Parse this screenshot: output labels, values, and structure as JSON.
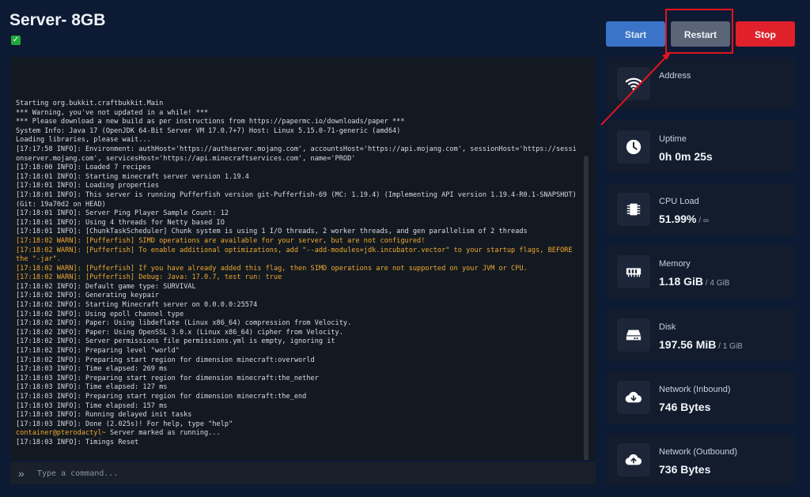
{
  "server": {
    "title": "Server- 8GB",
    "status_icon": "check-icon"
  },
  "controls": {
    "start_label": "Start",
    "restart_label": "Restart",
    "stop_label": "Stop"
  },
  "console": {
    "lines": [
      {
        "text": "Starting org.bukkit.craftbukkit.Main",
        "type": "info"
      },
      {
        "text": "*** Warning, you've not updated in a while! ***",
        "type": "info"
      },
      {
        "text": "*** Please download a new build as per instructions from https://papermc.io/downloads/paper ***",
        "type": "info"
      },
      {
        "text": "System Info: Java 17 (OpenJDK 64-Bit Server VM 17.0.7+7) Host: Linux 5.15.0-71-generic (amd64)",
        "type": "info"
      },
      {
        "text": "Loading libraries, please wait...",
        "type": "info"
      },
      {
        "text": "[17:17:58 INFO]: Environment: authHost='https://authserver.mojang.com', accountsHost='https://api.mojang.com', sessionHost='https://sessionserver.mojang.com', servicesHost='https://api.minecraftservices.com', name='PROD'",
        "type": "info"
      },
      {
        "text": "[17:18:00 INFO]: Loaded 7 recipes",
        "type": "info"
      },
      {
        "text": "[17:18:01 INFO]: Starting minecraft server version 1.19.4",
        "type": "info"
      },
      {
        "text": "[17:18:01 INFO]: Loading properties",
        "type": "info"
      },
      {
        "text": "[17:18:01 INFO]: This server is running Pufferfish version git-Pufferfish-69 (MC: 1.19.4) (Implementing API version 1.19.4-R0.1-SNAPSHOT) (Git: 19a70d2 on HEAD)",
        "type": "info"
      },
      {
        "text": "[17:18:01 INFO]: Server Ping Player Sample Count: 12",
        "type": "info"
      },
      {
        "text": "[17:18:01 INFO]: Using 4 threads for Netty based IO",
        "type": "info"
      },
      {
        "text": "[17:18:01 INFO]: [ChunkTaskScheduler] Chunk system is using 1 I/O threads, 2 worker threads, and gen parallelism of 2 threads",
        "type": "info"
      },
      {
        "text": "[17:18:02 WARN]: [Pufferfish] SIMD operations are available for your server, but are not configured!",
        "type": "warn"
      },
      {
        "text": "[17:18:02 WARN]: [Pufferfish] To enable additional optimizations, add \"--add-modules=jdk.incubator.vector\" to your startup flags, BEFORE the \"-jar\".",
        "type": "warn"
      },
      {
        "text": "[17:18:02 WARN]: [Pufferfish] If you have already added this flag, then SIMD operations are not supported on your JVM or CPU.",
        "type": "warn"
      },
      {
        "text": "[17:18:02 WARN]: [Pufferfish] Debug: Java: 17.0.7, test run: true",
        "type": "warn"
      },
      {
        "text": "[17:18:02 INFO]: Default game type: SURVIVAL",
        "type": "info"
      },
      {
        "text": "[17:18:02 INFO]: Generating keypair",
        "type": "info"
      },
      {
        "text": "[17:18:02 INFO]: Starting Minecraft server on 0.0.0.0:25574",
        "type": "info"
      },
      {
        "text": "[17:18:02 INFO]: Using epoll channel type",
        "type": "info"
      },
      {
        "text": "[17:18:02 INFO]: Paper: Using libdeflate (Linux x86_64) compression from Velocity.",
        "type": "info"
      },
      {
        "text": "[17:18:02 INFO]: Paper: Using OpenSSL 3.0.x (Linux x86_64) cipher from Velocity.",
        "type": "info"
      },
      {
        "text": "[17:18:02 INFO]: Server permissions file permissions.yml is empty, ignoring it",
        "type": "info"
      },
      {
        "text": "[17:18:02 INFO]: Preparing level \"world\"",
        "type": "info"
      },
      {
        "text": "[17:18:02 INFO]: Preparing start region for dimension minecraft:overworld",
        "type": "info"
      },
      {
        "text": "[17:18:03 INFO]: Time elapsed: 269 ms",
        "type": "info"
      },
      {
        "text": "[17:18:03 INFO]: Preparing start region for dimension minecraft:the_nether",
        "type": "info"
      },
      {
        "text": "[17:18:03 INFO]: Time elapsed: 127 ms",
        "type": "info"
      },
      {
        "text": "[17:18:03 INFO]: Preparing start region for dimension minecraft:the_end",
        "type": "info"
      },
      {
        "text": "[17:18:03 INFO]: Time elapsed: 157 ms",
        "type": "info"
      },
      {
        "text": "[17:18:03 INFO]: Running delayed init tasks",
        "type": "info"
      },
      {
        "text": "[17:18:03 INFO]: Done (2.025s)! For help, type \"help\"",
        "type": "info"
      },
      {
        "prompt": "container@pterodactyl~",
        "text": " Server marked as running...",
        "type": "prompt"
      },
      {
        "text": "[17:18:03 INFO]: Timings Reset",
        "type": "info"
      }
    ],
    "input_placeholder": "Type a command...",
    "input_value": ""
  },
  "stats": [
    {
      "icon": "wifi-icon",
      "label": "Address",
      "value": "",
      "sub": ""
    },
    {
      "icon": "clock-icon",
      "label": "Uptime",
      "value": "0h 0m 25s",
      "sub": ""
    },
    {
      "icon": "cpu-icon",
      "label": "CPU Load",
      "value": "51.99%",
      "sub": " / ∞"
    },
    {
      "icon": "memory-icon",
      "label": "Memory",
      "value": "1.18 GiB",
      "sub": " / 4 GiB"
    },
    {
      "icon": "disk-icon",
      "label": "Disk",
      "value": "197.56 MiB",
      "sub": " / 1 GiB"
    },
    {
      "icon": "cloud-download-icon",
      "label": "Network (Inbound)",
      "value": "746 Bytes",
      "sub": ""
    },
    {
      "icon": "cloud-upload-icon",
      "label": "Network (Outbound)",
      "value": "736 Bytes",
      "sub": ""
    }
  ],
  "colors": {
    "background": "#0d1a33",
    "start": "#3b73c8",
    "restart": "#5b6578",
    "stop": "#e0202a",
    "warn": "#f0a830",
    "highlight": "#e0151e"
  }
}
